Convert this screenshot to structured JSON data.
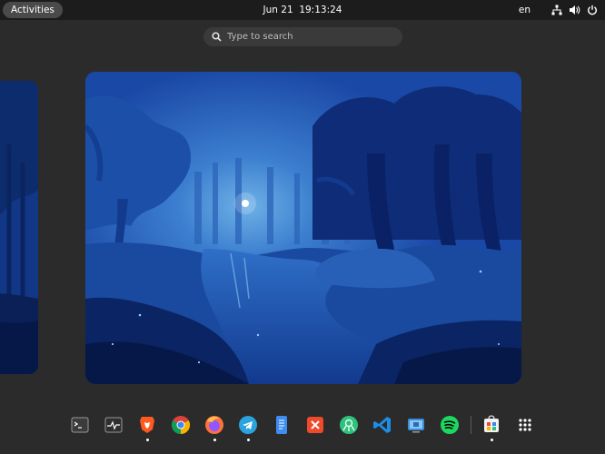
{
  "topbar": {
    "activities_label": "Activities",
    "date": "Jun 21",
    "time": "19:13:24",
    "keyboard_layout": "en",
    "tray_icons": [
      "network-icon",
      "volume-icon",
      "power-icon"
    ]
  },
  "search": {
    "placeholder": "Type to search",
    "icon": "search-icon"
  },
  "workspaces": {
    "wallpaper": "blue night forest with river and moon",
    "count_visible": 2
  },
  "dock": {
    "apps": [
      {
        "name": "terminal",
        "icon": "terminal-icon",
        "running": false
      },
      {
        "name": "system-monitor",
        "icon": "system-monitor-icon",
        "running": false
      },
      {
        "name": "brave-browser",
        "icon": "brave-icon",
        "running": true
      },
      {
        "name": "chrome",
        "icon": "chrome-icon",
        "running": false
      },
      {
        "name": "firefox",
        "icon": "firefox-icon",
        "running": true
      },
      {
        "name": "telegram",
        "icon": "telegram-icon",
        "running": true
      },
      {
        "name": "text-editor",
        "icon": "text-editor-icon",
        "running": false
      },
      {
        "name": "xmind",
        "icon": "xmind-icon",
        "running": false
      },
      {
        "name": "gitkraken",
        "icon": "gitkraken-icon",
        "running": false
      },
      {
        "name": "vscode",
        "icon": "vscode-icon",
        "running": false
      },
      {
        "name": "screen-share",
        "icon": "remote-desktop-icon",
        "running": false
      },
      {
        "name": "spotify",
        "icon": "spotify-icon",
        "running": false
      },
      {
        "name": "software",
        "icon": "software-center-icon",
        "running": true
      },
      {
        "name": "show-apps",
        "icon": "app-grid-icon",
        "running": false
      }
    ]
  },
  "colors": {
    "topbar_bg": "#1c1c1c",
    "background": "#2b2b2b",
    "search_bg": "#3a3a3a",
    "activities_bg": "#4a4a4a",
    "wallpaper_blue": "#1740a0"
  }
}
